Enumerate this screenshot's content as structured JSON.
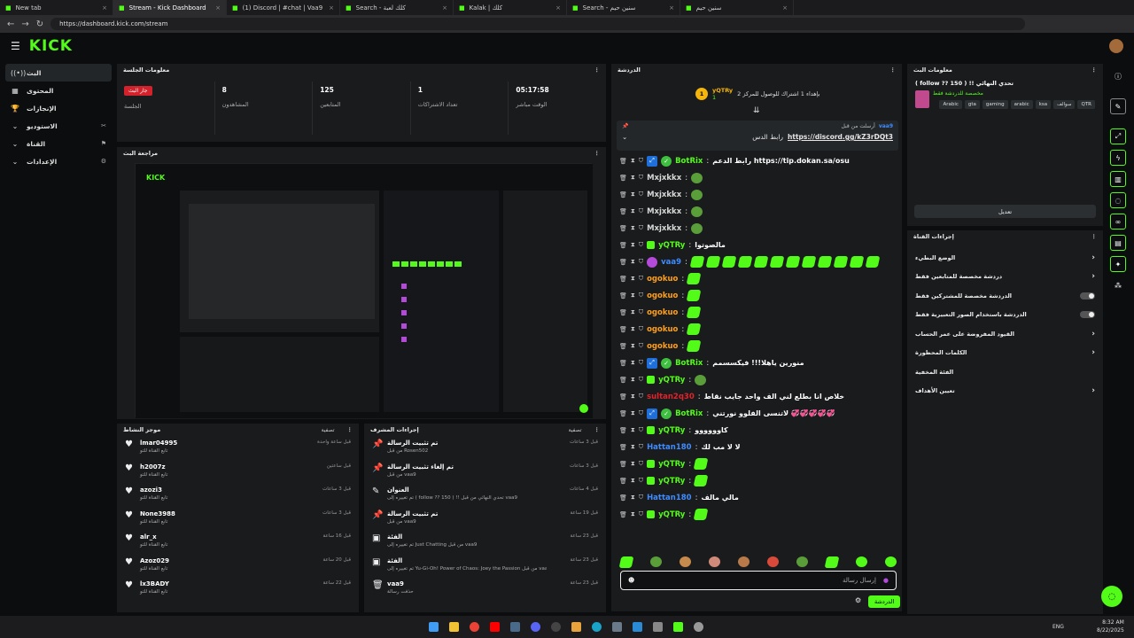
{
  "browser": {
    "tabs": [
      {
        "title": "New tab"
      },
      {
        "title": "Stream - Kick Dashboard"
      },
      {
        "title": "(1) Discord | #chat | Vaa9"
      },
      {
        "title": "Search - كلك لعبة"
      },
      {
        "title": "Kalak | كلك"
      },
      {
        "title": "Search - سنين حيم"
      },
      {
        "title": "سنين حيم"
      }
    ],
    "url": "https://dashboard.kick.com/stream"
  },
  "header": {
    "logo": "KICK"
  },
  "nav": [
    {
      "label": "البث",
      "icon": "broadcast-icon"
    },
    {
      "label": "المحتوى",
      "icon": "content-icon"
    },
    {
      "label": "الإنجازات",
      "icon": "trophy-icon"
    },
    {
      "label": "الاستوديو",
      "icon": "studio-icon"
    },
    {
      "label": "القناة",
      "icon": "channel-icon"
    },
    {
      "label": "الإعدادات",
      "icon": "settings-icon"
    }
  ],
  "session": {
    "title": "معلومات الجلسة",
    "live_label": "جار البث",
    "stats": [
      {
        "value": "",
        "label": "الجلسة"
      },
      {
        "value": "8",
        "label": "المشاهدون"
      },
      {
        "value": "125",
        "label": "المتابعين"
      },
      {
        "value": "1",
        "label": "تعداد الاشتراكات"
      },
      {
        "value": "05:17:58",
        "label": "الوقت مباشر"
      }
    ]
  },
  "preview": {
    "title": "مراجعة البث"
  },
  "activity": {
    "title": "موجز النشاط",
    "filter": "تصفية",
    "items": [
      {
        "name": "lmar04995",
        "sub": "تابع القناة للتو",
        "time": "قبل ساعة واحدة"
      },
      {
        "name": "h2007z",
        "sub": "تابع القناة للتو",
        "time": "قبل ساعتين"
      },
      {
        "name": "azozi3",
        "sub": "تابع القناة للتو",
        "time": "قبل 3 ساعات"
      },
      {
        "name": "None3988",
        "sub": "تابع القناة للتو",
        "time": "قبل 3 ساعات"
      },
      {
        "name": "alr_x",
        "sub": "تابع القناة للتو",
        "time": "قبل 16 ساعة"
      },
      {
        "name": "Azoz029",
        "sub": "تابع القناة للتو",
        "time": "قبل 20 ساعة"
      },
      {
        "name": "lx3BADY",
        "sub": "تابع القناة للتو",
        "time": "قبل 22 ساعة"
      }
    ]
  },
  "modactions": {
    "title": "إجراءات المشرف",
    "filter": "تصفية",
    "items": [
      {
        "icon": "pin-icon",
        "title": "تم تثبيت الرسالة",
        "sub": "من قبل Rosen502",
        "time": "قبل 3 ساعات"
      },
      {
        "icon": "pin-icon",
        "title": "تم إلغاء تثبيت الرسالة",
        "sub": "من قبل vaa9",
        "time": "قبل 3 ساعات"
      },
      {
        "icon": "edit-icon",
        "title": "العنوان",
        "sub": "تم تغييره إلى ( follow ?? 150 ) !! تحدي النهائي من قبل vaa9",
        "time": "قبل 4 ساعات"
      },
      {
        "icon": "pin-icon",
        "title": "تم تثبيت الرسالة",
        "sub": "من قبل vaa9",
        "time": "قبل 19 ساعة"
      },
      {
        "icon": "category-icon",
        "title": "الفئة",
        "sub": "تم تغييره إلى Just Chatting من قبل vaa9",
        "time": "قبل 23 ساعة"
      },
      {
        "icon": "category-icon",
        "title": "الفئة",
        "sub": "تم تغييره إلى Yu-Gi-Oh! Power of Chaos: Joey the Passion من قبل vaa9",
        "time": "قبل 23 ساعة"
      },
      {
        "icon": "trash-icon",
        "title": "vaa9",
        "sub": "حذفت رسالة",
        "time": "قبل 23 ساعة"
      }
    ]
  },
  "chat": {
    "title": "الدردشة",
    "top_gifter": {
      "rank": "1",
      "name": "yQTRy",
      "count": "1",
      "note": "بإهداء 1 اشتراك للوصول للمركز 2"
    },
    "pinned": {
      "by": "vaa9",
      "by_label": "أرسلت من قبل",
      "text_label": "رابط الدس",
      "link": "https://discord.gg/kZ3rDQt3"
    },
    "messages": [
      {
        "user": "BotRix",
        "color": "#53fc18",
        "badges": [
          "bot",
          "verified"
        ],
        "text": "رابط الدعم https://tip.dokan.sa/osu",
        "emotes": 0
      },
      {
        "user": "Mxjxkkx",
        "color": "#d9d9d9",
        "badges": [],
        "text": "",
        "emotes": 1,
        "emote": "frog"
      },
      {
        "user": "Mxjxkkx",
        "color": "#d9d9d9",
        "badges": [],
        "text": "",
        "emotes": 1,
        "emote": "frog"
      },
      {
        "user": "Mxjxkkx",
        "color": "#d9d9d9",
        "badges": [],
        "text": "",
        "emotes": 1,
        "emote": "frog"
      },
      {
        "user": "Mxjxkkx",
        "color": "#d9d9d9",
        "badges": [],
        "text": "",
        "emotes": 1,
        "emote": "frog"
      },
      {
        "user": "yQTRy",
        "color": "#53fc18",
        "badges": [
          "sub"
        ],
        "text": "مالصوتوا",
        "emotes": 0
      },
      {
        "user": "vaa9",
        "color": "#3f8cff",
        "badges": [
          "mic"
        ],
        "text": "",
        "emotes": 12,
        "emote": "kick"
      },
      {
        "user": "ogokuo",
        "color": "#ff9f1c",
        "badges": [],
        "text": "",
        "emotes": 1,
        "emote": "kick"
      },
      {
        "user": "ogokuo",
        "color": "#ff9f1c",
        "badges": [],
        "text": "",
        "emotes": 1,
        "emote": "kick"
      },
      {
        "user": "ogokuo",
        "color": "#ff9f1c",
        "badges": [],
        "text": "",
        "emotes": 1,
        "emote": "kick"
      },
      {
        "user": "ogokuo",
        "color": "#ff9f1c",
        "badges": [],
        "text": "",
        "emotes": 1,
        "emote": "kick"
      },
      {
        "user": "ogokuo",
        "color": "#ff9f1c",
        "badges": [],
        "text": "",
        "emotes": 1,
        "emote": "kick"
      },
      {
        "user": "BotRix",
        "color": "#53fc18",
        "badges": [
          "bot",
          "verified"
        ],
        "text": "منورين ياهلا!!! فيكسسمم",
        "emotes": 0
      },
      {
        "user": "yQTRy",
        "color": "#53fc18",
        "badges": [
          "sub"
        ],
        "text": "",
        "emotes": 1,
        "emote": "frog"
      },
      {
        "user": "sultan2q30",
        "color": "#e2232a",
        "badges": [],
        "text": "خلاص انا بطلع لني الف واحد جايب نقاط",
        "emotes": 0
      },
      {
        "user": "BotRix",
        "color": "#53fc18",
        "badges": [
          "bot",
          "verified"
        ],
        "text": "لاتنسى الفلوو نورتني 💞💞💞💞💞",
        "emotes": 0
      },
      {
        "user": "yQTRy",
        "color": "#53fc18",
        "badges": [
          "sub"
        ],
        "text": "كاوووووو",
        "emotes": 0
      },
      {
        "user": "Hattan180",
        "color": "#3f8cff",
        "badges": [],
        "text": "لا لا مب لك",
        "emotes": 0
      },
      {
        "user": "yQTRy",
        "color": "#53fc18",
        "badges": [
          "sub"
        ],
        "text": "",
        "emotes": 1,
        "emote": "kick"
      },
      {
        "user": "yQTRy",
        "color": "#53fc18",
        "badges": [
          "sub"
        ],
        "text": "",
        "emotes": 1,
        "emote": "kick"
      },
      {
        "user": "Hattan180",
        "color": "#3f8cff",
        "badges": [],
        "text": "مالي مالف",
        "emotes": 0
      },
      {
        "user": "yQTRy",
        "color": "#53fc18",
        "badges": [
          "sub"
        ],
        "text": "",
        "emotes": 1,
        "emote": "kick"
      }
    ],
    "input_placeholder": "إرسال رسالة",
    "send_label": "الدردشة"
  },
  "stream_info": {
    "title": "معلومات البث",
    "stream_title": "( follow ?? 150 ) !! تحدي النهائي",
    "category": "مخصصة للدردشة فقط",
    "tags": [
      "QTR",
      "سوالف",
      "ksa",
      "arabic",
      "gaming",
      "gta",
      "Arabic"
    ],
    "edit_label": "تعديل"
  },
  "quick_actions": {
    "title": "إجراءات القناة",
    "items": [
      {
        "label": "الوضع البطيء",
        "control": "arrow"
      },
      {
        "label": "دردشة مخصصة للمتابعين فقط",
        "control": "arrow"
      },
      {
        "label": "الدردشة مخصصة للمشتركين فقط",
        "control": "toggle"
      },
      {
        "label": "الدردشة باستخدام الصور التعبيرية فقط",
        "control": "toggle"
      },
      {
        "label": "القيود المفروضة على عمر الحساب",
        "control": "arrow"
      },
      {
        "label": "الكلمات المحظورة",
        "control": "arrow"
      },
      {
        "label": "الفئة المخفية",
        "control": "none"
      },
      {
        "label": "تعيين الأهداف",
        "control": "arrow"
      }
    ]
  },
  "taskbar": {
    "lang": "ENG",
    "time": "8:32 AM",
    "date": "8/22/2025"
  },
  "colors": {
    "brand": "#53fc18",
    "live": "#d3222b",
    "panel": "#191b1d",
    "bg": "#0b0d0e"
  }
}
